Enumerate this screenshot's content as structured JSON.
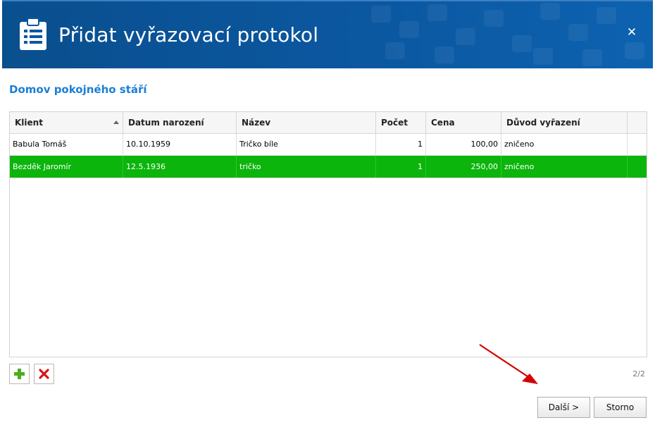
{
  "dialog": {
    "title": "Přidat vyřazovací protokol",
    "close_icon": "close-icon",
    "header_icon": "clipboard-list-icon",
    "accent_color": "#0b57a0"
  },
  "section": {
    "title": "Domov pokojného stáří"
  },
  "table": {
    "columns": [
      "Klient",
      "Datum narození",
      "Název",
      "Počet",
      "Cena",
      "Důvod vyřazení"
    ],
    "sort_column": "Klient",
    "sort_direction": "ascending",
    "rows": [
      {
        "klient": "Babula Tomáš",
        "datum": "10.10.1959",
        "nazev": "Tričko bíle",
        "pocet": "1",
        "cena": "100,00",
        "duvod": "zničeno",
        "selected": false
      },
      {
        "klient": "Bezděk Jaromír",
        "datum": "12.5.1936",
        "nazev": "tričko",
        "pocet": "1",
        "cena": "250,00",
        "duvod": "zničeno",
        "selected": true
      }
    ],
    "selected_row_color": "#0bb50b"
  },
  "toolbar": {
    "add_icon": "plus-icon",
    "delete_icon": "delete-x-icon"
  },
  "pager": {
    "text": "2/2"
  },
  "buttons": {
    "next": "Další >",
    "cancel": "Storno"
  }
}
